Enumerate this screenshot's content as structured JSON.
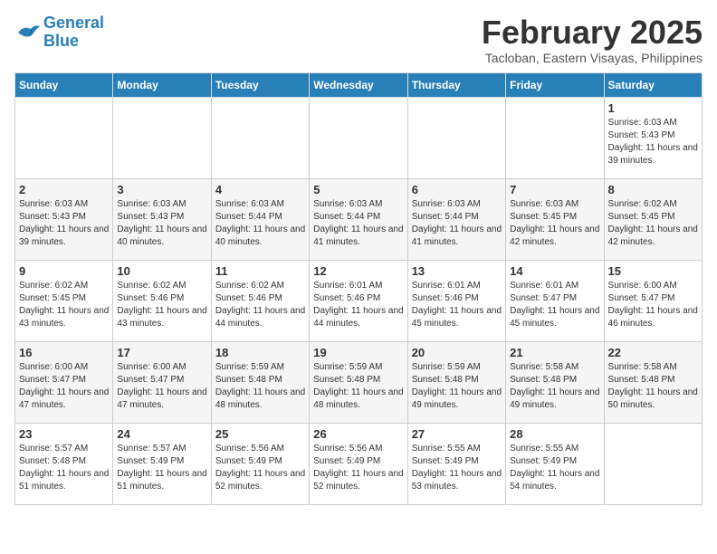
{
  "header": {
    "logo_line1": "General",
    "logo_line2": "Blue",
    "month": "February 2025",
    "location": "Tacloban, Eastern Visayas, Philippines"
  },
  "weekdays": [
    "Sunday",
    "Monday",
    "Tuesday",
    "Wednesday",
    "Thursday",
    "Friday",
    "Saturday"
  ],
  "weeks": [
    [
      {
        "day": "",
        "info": ""
      },
      {
        "day": "",
        "info": ""
      },
      {
        "day": "",
        "info": ""
      },
      {
        "day": "",
        "info": ""
      },
      {
        "day": "",
        "info": ""
      },
      {
        "day": "",
        "info": ""
      },
      {
        "day": "1",
        "info": "Sunrise: 6:03 AM\nSunset: 5:43 PM\nDaylight: 11 hours and 39 minutes."
      }
    ],
    [
      {
        "day": "2",
        "info": "Sunrise: 6:03 AM\nSunset: 5:43 PM\nDaylight: 11 hours and 39 minutes."
      },
      {
        "day": "3",
        "info": "Sunrise: 6:03 AM\nSunset: 5:43 PM\nDaylight: 11 hours and 40 minutes."
      },
      {
        "day": "4",
        "info": "Sunrise: 6:03 AM\nSunset: 5:44 PM\nDaylight: 11 hours and 40 minutes."
      },
      {
        "day": "5",
        "info": "Sunrise: 6:03 AM\nSunset: 5:44 PM\nDaylight: 11 hours and 41 minutes."
      },
      {
        "day": "6",
        "info": "Sunrise: 6:03 AM\nSunset: 5:44 PM\nDaylight: 11 hours and 41 minutes."
      },
      {
        "day": "7",
        "info": "Sunrise: 6:03 AM\nSunset: 5:45 PM\nDaylight: 11 hours and 42 minutes."
      },
      {
        "day": "8",
        "info": "Sunrise: 6:02 AM\nSunset: 5:45 PM\nDaylight: 11 hours and 42 minutes."
      }
    ],
    [
      {
        "day": "9",
        "info": "Sunrise: 6:02 AM\nSunset: 5:45 PM\nDaylight: 11 hours and 43 minutes."
      },
      {
        "day": "10",
        "info": "Sunrise: 6:02 AM\nSunset: 5:46 PM\nDaylight: 11 hours and 43 minutes."
      },
      {
        "day": "11",
        "info": "Sunrise: 6:02 AM\nSunset: 5:46 PM\nDaylight: 11 hours and 44 minutes."
      },
      {
        "day": "12",
        "info": "Sunrise: 6:01 AM\nSunset: 5:46 PM\nDaylight: 11 hours and 44 minutes."
      },
      {
        "day": "13",
        "info": "Sunrise: 6:01 AM\nSunset: 5:46 PM\nDaylight: 11 hours and 45 minutes."
      },
      {
        "day": "14",
        "info": "Sunrise: 6:01 AM\nSunset: 5:47 PM\nDaylight: 11 hours and 45 minutes."
      },
      {
        "day": "15",
        "info": "Sunrise: 6:00 AM\nSunset: 5:47 PM\nDaylight: 11 hours and 46 minutes."
      }
    ],
    [
      {
        "day": "16",
        "info": "Sunrise: 6:00 AM\nSunset: 5:47 PM\nDaylight: 11 hours and 47 minutes."
      },
      {
        "day": "17",
        "info": "Sunrise: 6:00 AM\nSunset: 5:47 PM\nDaylight: 11 hours and 47 minutes."
      },
      {
        "day": "18",
        "info": "Sunrise: 5:59 AM\nSunset: 5:48 PM\nDaylight: 11 hours and 48 minutes."
      },
      {
        "day": "19",
        "info": "Sunrise: 5:59 AM\nSunset: 5:48 PM\nDaylight: 11 hours and 48 minutes."
      },
      {
        "day": "20",
        "info": "Sunrise: 5:59 AM\nSunset: 5:48 PM\nDaylight: 11 hours and 49 minutes."
      },
      {
        "day": "21",
        "info": "Sunrise: 5:58 AM\nSunset: 5:48 PM\nDaylight: 11 hours and 49 minutes."
      },
      {
        "day": "22",
        "info": "Sunrise: 5:58 AM\nSunset: 5:48 PM\nDaylight: 11 hours and 50 minutes."
      }
    ],
    [
      {
        "day": "23",
        "info": "Sunrise: 5:57 AM\nSunset: 5:48 PM\nDaylight: 11 hours and 51 minutes."
      },
      {
        "day": "24",
        "info": "Sunrise: 5:57 AM\nSunset: 5:49 PM\nDaylight: 11 hours and 51 minutes."
      },
      {
        "day": "25",
        "info": "Sunrise: 5:56 AM\nSunset: 5:49 PM\nDaylight: 11 hours and 52 minutes."
      },
      {
        "day": "26",
        "info": "Sunrise: 5:56 AM\nSunset: 5:49 PM\nDaylight: 11 hours and 52 minutes."
      },
      {
        "day": "27",
        "info": "Sunrise: 5:55 AM\nSunset: 5:49 PM\nDaylight: 11 hours and 53 minutes."
      },
      {
        "day": "28",
        "info": "Sunrise: 5:55 AM\nSunset: 5:49 PM\nDaylight: 11 hours and 54 minutes."
      },
      {
        "day": "",
        "info": ""
      }
    ]
  ]
}
